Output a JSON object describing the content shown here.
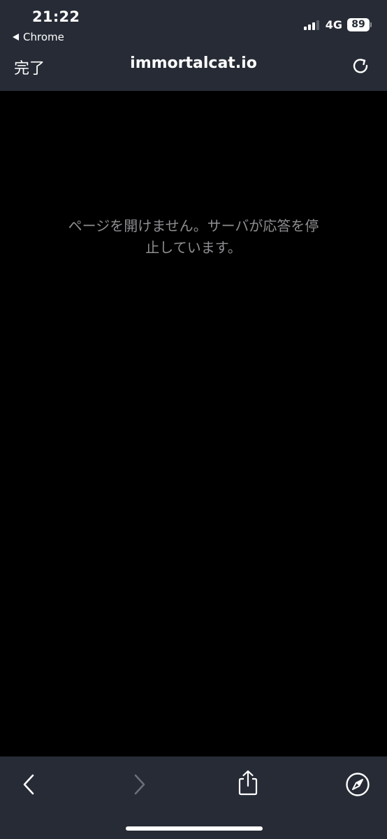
{
  "status_bar": {
    "time": "21:22",
    "back_app_label": "Chrome",
    "network": "4G",
    "battery": "89",
    "signal_bars": 3,
    "signal_total": 4
  },
  "nav_bar": {
    "done_label": "完了",
    "url": "immortalcat.io",
    "reload_icon": "reload-icon"
  },
  "content": {
    "error_line_1": "ページを開けません。サーバが応答を停",
    "error_line_2": "止しています。"
  },
  "toolbar": {
    "back_icon": "chevron-left-icon",
    "forward_icon": "chevron-right-icon",
    "share_icon": "share-icon",
    "safari_icon": "compass-icon"
  },
  "colors": {
    "bar_background": "#262b35",
    "content_background": "#000000",
    "message_text": "#8e8e93",
    "disabled_icon": "#6b6f78"
  }
}
